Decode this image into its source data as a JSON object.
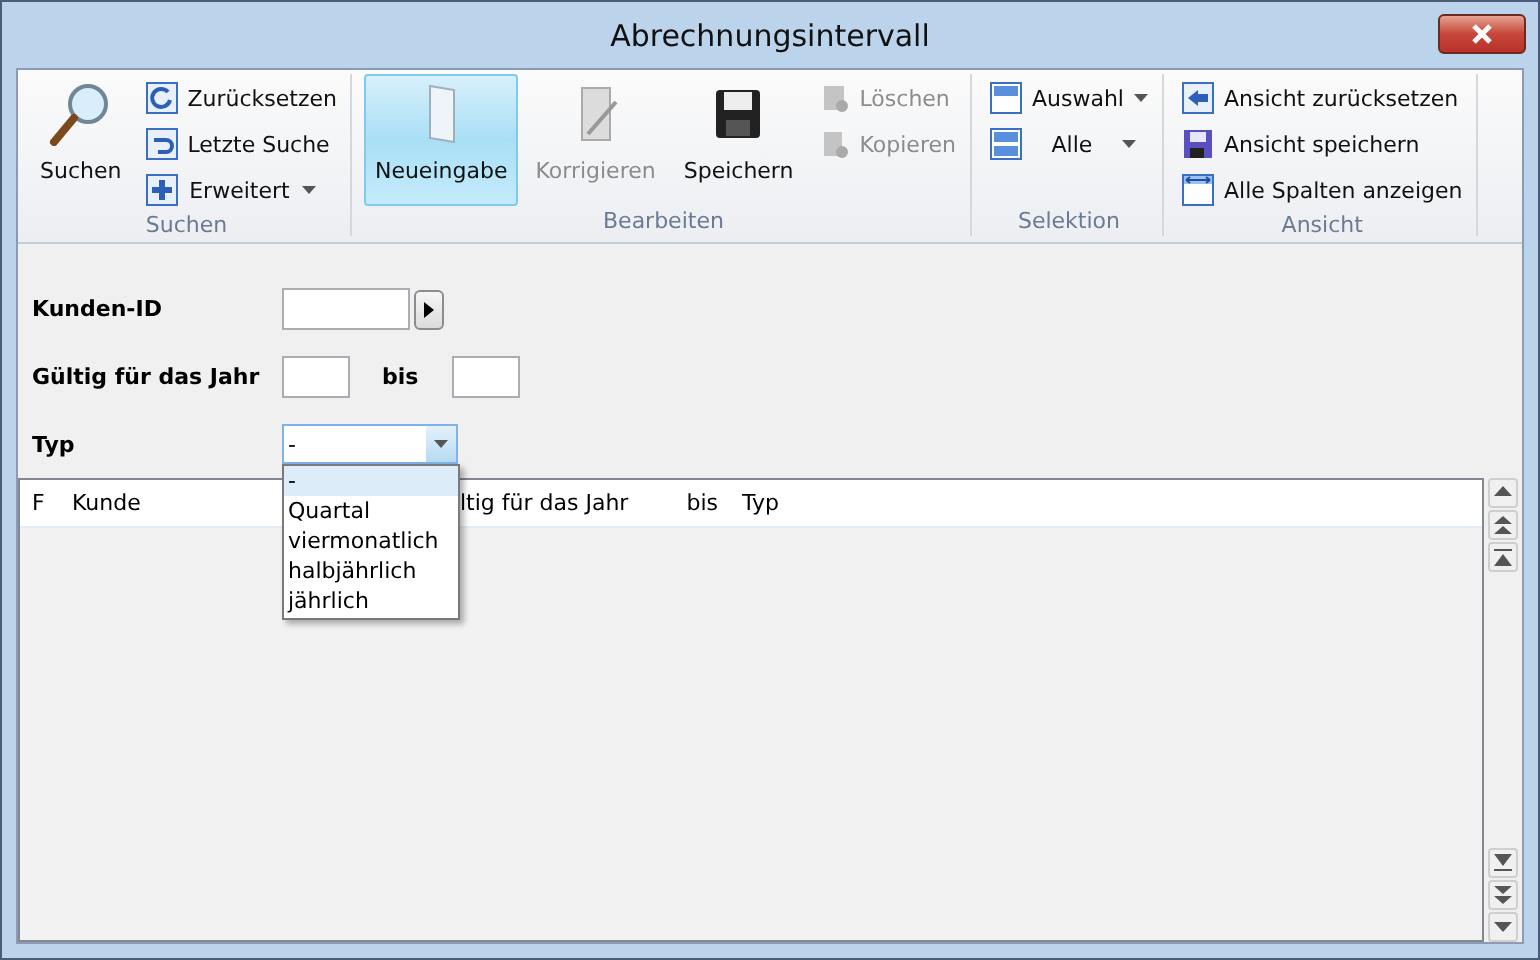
{
  "window": {
    "title": "Abrechnungsintervall"
  },
  "ribbon": {
    "groups": [
      {
        "label": "Suchen",
        "columns": [
          {
            "kind": "large",
            "label": "Suchen",
            "disabled": false,
            "selected": false
          },
          {
            "kind": "stack",
            "items": [
              {
                "label": "Zurücksetzen",
                "disabled": false,
                "dropdown": false
              },
              {
                "label": "Letzte Suche",
                "disabled": false,
                "dropdown": false
              },
              {
                "label": "Erweitert",
                "disabled": false,
                "dropdown": true
              }
            ]
          }
        ]
      },
      {
        "label": "Bearbeiten",
        "columns": [
          {
            "kind": "large",
            "label": "Neueingabe",
            "disabled": false,
            "selected": true
          },
          {
            "kind": "large",
            "label": "Korrigieren",
            "disabled": true,
            "selected": false
          },
          {
            "kind": "large",
            "label": "Speichern",
            "disabled": false,
            "selected": false
          },
          {
            "kind": "stack",
            "items": [
              {
                "label": "Löschen",
                "disabled": true,
                "dropdown": false
              },
              {
                "label": "Kopieren",
                "disabled": true,
                "dropdown": false
              }
            ]
          }
        ]
      },
      {
        "label": "Selektion",
        "columns": [
          {
            "kind": "stack",
            "items": [
              {
                "label": "Auswahl",
                "disabled": false,
                "dropdown": true
              },
              {
                "label": "Alle",
                "disabled": false,
                "dropdown": true
              }
            ]
          }
        ]
      },
      {
        "label": "Ansicht",
        "columns": [
          {
            "kind": "stack",
            "items": [
              {
                "label": "Ansicht zurücksetzen",
                "disabled": false,
                "dropdown": false
              },
              {
                "label": "Ansicht speichern",
                "disabled": false,
                "dropdown": false
              },
              {
                "label": "Alle Spalten anzeigen",
                "disabled": false,
                "dropdown": false
              }
            ]
          }
        ]
      }
    ]
  },
  "form": {
    "customer_id": {
      "label": "Kunden-ID"
    },
    "year": {
      "label": "Gültig für das Jahr",
      "to_label": "bis"
    },
    "type": {
      "label": "Typ",
      "value": "-",
      "expanded": true,
      "options": [
        {
          "label": "-",
          "selected": true
        },
        {
          "label": "Quartal",
          "selected": false
        },
        {
          "label": "viermonatlich",
          "selected": false
        },
        {
          "label": "halbjährlich",
          "selected": false
        },
        {
          "label": "jährlich",
          "selected": false
        }
      ]
    }
  },
  "table": {
    "columns": [
      "F",
      "Kunde",
      "ltig für das Jahr",
      "bis",
      "Typ"
    ]
  }
}
